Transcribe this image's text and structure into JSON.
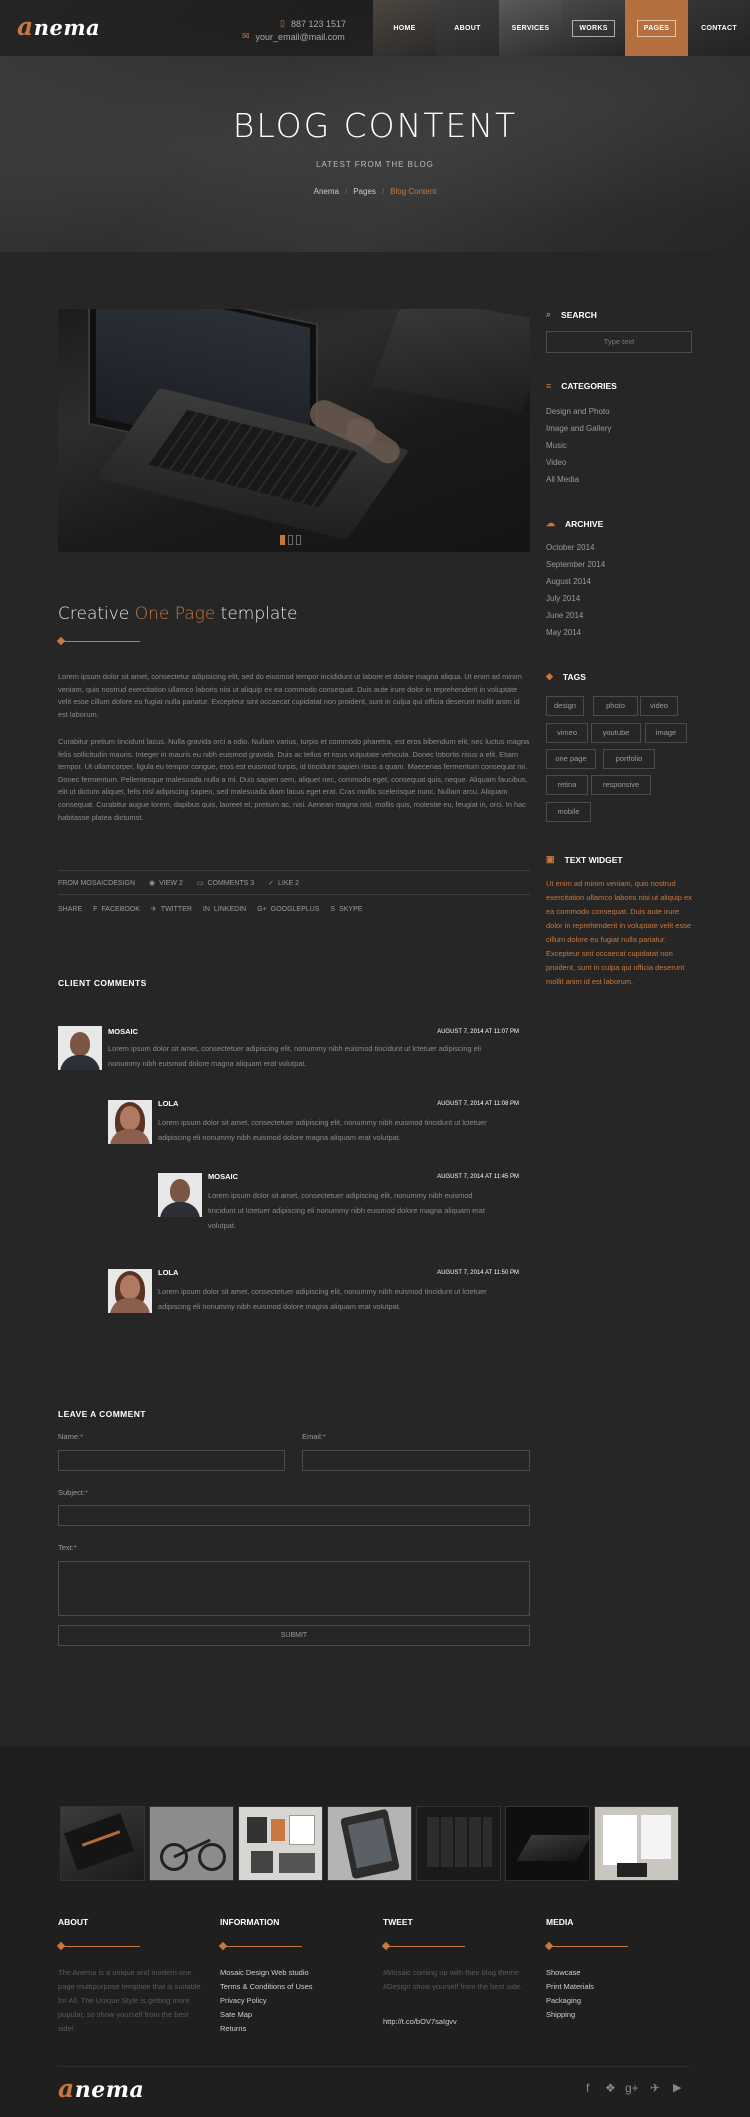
{
  "header": {
    "logo_initial": "a",
    "logo_rest": "nema",
    "phone": "887 123 1517",
    "email": "your_email@mail.com",
    "nav": [
      "HOME",
      "ABOUT",
      "SERVICES",
      "WORKS",
      "PAGES",
      "CONTACT"
    ],
    "active_nav": "PAGES",
    "accent_color": "#c8773f"
  },
  "hero": {
    "title": "BLOG CONTENT",
    "subtitle": "LATEST FROM THE BLOG",
    "breadcrumb": [
      "Anema",
      "Pages",
      "Blog Content"
    ]
  },
  "post": {
    "title_pre": "Creative ",
    "title_hl": "One Page",
    "title_post": " template",
    "para1": "Lorem ipsum dolor sit amet, consectetur adipisicing elit, sed do eiusmod tempor incididunt ut labore et dolore magna aliqua. Ut enim ad minim veniam, quis nostrud exercitation ullamco laboris nisi ut aliquip ex ea commodo consequat. Duis aute irure dolor in reprehenderit in voluptate velit esse cillum dolore eu fugiat nulla pariatur. Excepteur sint occaecat cupidatat non proident, sunt in culpa qui officia deserunt mollit anim id est laborum.",
    "para2": "Curabitur pretium tincidunt lacus. Nulla gravida orci a odio. Nullam varius, turpis et commodo pharetra, est eros bibendum elit, nec luctus magna felis sollicitudin mauris. Integer in mauris eu nibh euismod gravida. Duis ac tellus et risus vulputate vehicula. Donec lobortis risus a elit. Etiam tempor. Ut ullamcorper, ligula eu tempor congue, eros est euismod turpis, id tincidunt sapien risus a quam. Maecenas fermentum consequat mi. Donec fermentum. Pellentesque malesuada nulla a mi. Duis sapien sem, aliquet nec, commodo eget, consequat quis, neque. Aliquam faucibus, elit ut dictum aliquet, felis nisl adipiscing sapien, sed malesuada diam lacus eget erat. Cras mollis scelerisque nunc. Nullam arcu. Aliquam consequat. Curabitur augue lorem, dapibus quis, laoreet et, pretium ac, nisi. Aenean magna nisl, mollis quis, molestie eu, feugiat in, orci. In hac habitasse platea dictumst.",
    "meta": {
      "from": "FROM MOSAICDESIGN",
      "view": "VIEW 2",
      "comments": "COMMENTS 3",
      "like": "LIKE 2"
    },
    "share_label": "SHARE",
    "share": [
      "FACEBOOK",
      "TWITTER",
      "LINKEDIN",
      "GOOGLEPLUS",
      "SKYPE"
    ],
    "slider_dots": 3,
    "slider_active": 1
  },
  "comments": {
    "title": "CLIENT COMMENTS",
    "items": [
      {
        "name": "MOSAIC",
        "date": "AUGUST 7, 2014 AT 11:07 PM",
        "text1": "Lorem ipsum dolor sit amet, consectetuer adipiscing elit, nonummy nibh euismod tincidunt ut lctetuer adipiscing eli",
        "text2": "nonummy nibh euismod dolore magna aliquam erat volutpat."
      },
      {
        "name": "LOLA",
        "date": "AUGUST 7, 2014 AT 11:08 PM",
        "text1": "Lorem ipsum dolor sit amet, consectetuer adipiscing elit, nonummy nibh euismod tincidunt ut lctetuer",
        "text2": "adipiscing eli nonummy nibh euismod dolore magna aliquam erat volutpat."
      },
      {
        "name": "MOSAIC",
        "date": "AUGUST 7, 2014 AT 11:45 PM",
        "text1": "Lorem ipsum dolor sit amet, consectetuer adipiscing elit, nonummy nibh euismod",
        "text2": "tincidunt ut lctetuer adipiscing eli nonummy nibh euismod dolore magna aliquam erat",
        "text3": "volutpat."
      },
      {
        "name": "LOLA",
        "date": "AUGUST 7, 2014 AT 11:50 PM",
        "text1": "Lorem ipsum dolor sit amet, consectetuer adipiscing elit, nonummy nibh euismod tincidunt ut lctetuer",
        "text2": "adipiscing eli nonummy nibh euismod dolore magna aliquam erat volutpat."
      }
    ]
  },
  "form": {
    "title": "LEAVE A COMMENT",
    "name_label": "Name:",
    "email_label": "Email:",
    "subject_label": "Subject:",
    "text_label": "Text:",
    "required_mark": "*",
    "submit": "SUBMIT"
  },
  "sidebar": {
    "search_title": "SEARCH",
    "search_placeholder": "Type text",
    "categories_title": "CATEGORIES",
    "categories": [
      "Design and Photo",
      "Image and Gallery",
      "Music",
      "Video",
      "All Media"
    ],
    "archive_title": "ARCHIVE",
    "archive": [
      "October 2014",
      "September 2014",
      "August 2014",
      "July 2014",
      "June 2014",
      "May 2014"
    ],
    "tags_title": "TAGS",
    "tags": [
      "design",
      "photo",
      "video",
      "vimeo",
      "youtube",
      "image",
      "one page",
      "portfolio",
      "retina",
      "responsive",
      "mobile"
    ],
    "textwidget_title": "TEXT WIDGET",
    "textwidget_text": "Ut enim ad minim veniam, quis nostrud exercitation ullamco laboris nisi ut aliquip ex ea commodo consequat. Duis aute irure dolor in reprehenderit in voluptate velit esse cillum dolore eu fugiat nulla pariatur. Excepteur sint occaecat cupidatat non proident, sunt in culpa qui officia deserunt mollit anim id est laborum."
  },
  "footer": {
    "about_title": "ABOUT",
    "about_text": "The Anema is a unique and modern one page multipurpose template that is suitable for All. The Unique Style is getting more popular, so show yourself from the best side!",
    "info_title": "INFORMATION",
    "info_links": [
      "Mosaic Design Web studio",
      "Terms & Conditions of Uses",
      "Privacy Policy",
      "Sate Map",
      "Returns"
    ],
    "tweet_title": "TWEET",
    "tweet_text": "#Mosaic coming up with their blog theme #Design show yourself from the best side.",
    "tweet_link": "http://t.co/bOV7saIgvv",
    "media_title": "MEDIA",
    "media_links": [
      "Showcase",
      "Print Materials",
      "Packaging",
      "Shipping"
    ],
    "logo_initial": "a",
    "logo_rest": "nema",
    "social_icons": [
      "facebook-icon",
      "dropbox-icon",
      "googleplus-icon",
      "twitter-icon",
      "youtube-icon"
    ]
  }
}
